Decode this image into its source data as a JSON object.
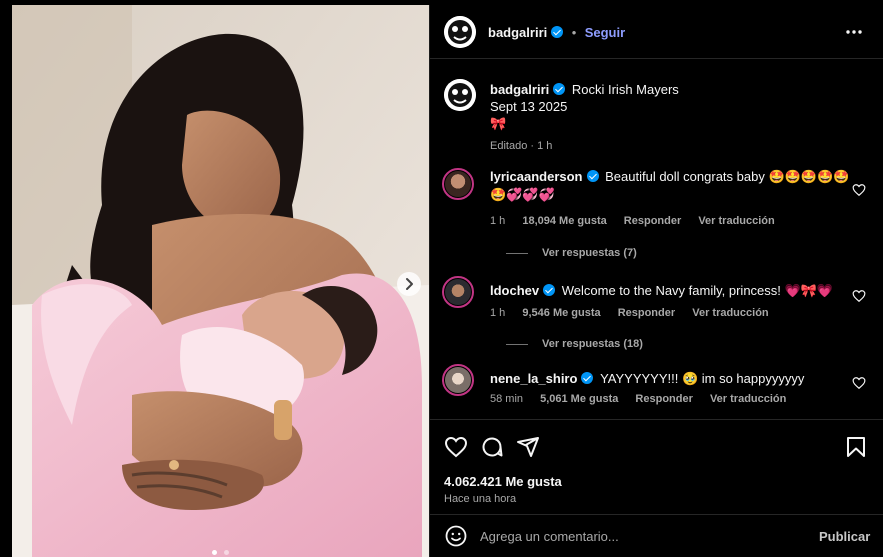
{
  "post": {
    "username": "badgalriri",
    "follow_label": "Seguir",
    "caption_text": "Rocki Irish Mayers",
    "caption_date": "Sept 13 2025",
    "caption_emoji": "🎀",
    "edited_label": "Editado · 1 h"
  },
  "comments": [
    {
      "user": "lyricaanderson",
      "text": "Beautiful doll congrats baby 🤩🤩🤩🤩🤩🤩💞💞💞",
      "time": "1 h",
      "likes": "18,094 Me gusta",
      "reply": "Responder",
      "translate": "Ver traducción",
      "replies": "Ver respuestas (7)"
    },
    {
      "user": "ldochev",
      "text": "Welcome to the Navy family, princess! 💗🎀💗",
      "time": "1 h",
      "likes": "9,546 Me gusta",
      "reply": "Responder",
      "translate": "Ver traducción",
      "replies": "Ver respuestas (18)"
    },
    {
      "user": "nene_la_shiro",
      "text": "YAYYYYYY!!! 🥹 im so happyyyyyy",
      "time": "58 min",
      "likes": "5,061 Me gusta",
      "reply": "Responder",
      "translate": "Ver traducción"
    }
  ],
  "footer": {
    "likes": "4.062.421 Me gusta",
    "time": "Hace una hora",
    "comment_placeholder": "Agrega un comentario...",
    "publish_label": "Publicar"
  },
  "colors": {
    "accent": "#0095f6",
    "follow": "#8e9dfe",
    "background": "#000000",
    "muted": "#a8a8a8"
  },
  "icons": [
    "more-options-icon",
    "heart-icon",
    "comment-icon",
    "share-icon",
    "bookmark-icon",
    "emoji-icon",
    "next-image-icon"
  ]
}
